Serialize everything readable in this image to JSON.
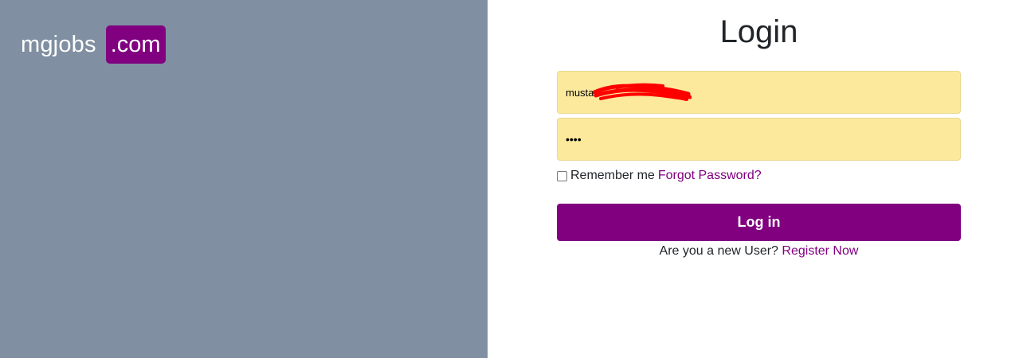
{
  "brand": {
    "name": "mgjobs",
    "suffix": ".com"
  },
  "login": {
    "title": "Login",
    "email_value": "musta",
    "password_value": "••••",
    "remember_label": "Remember me",
    "forgot_link": "Forgot Password?",
    "submit_label": "Log in",
    "new_user_prompt": "Are you a new User?",
    "register_link": "Register Now"
  },
  "colors": {
    "accent": "#800080",
    "left_panel": "#808fa1",
    "input_bg": "#fde99c",
    "redaction": "#ff0000"
  }
}
